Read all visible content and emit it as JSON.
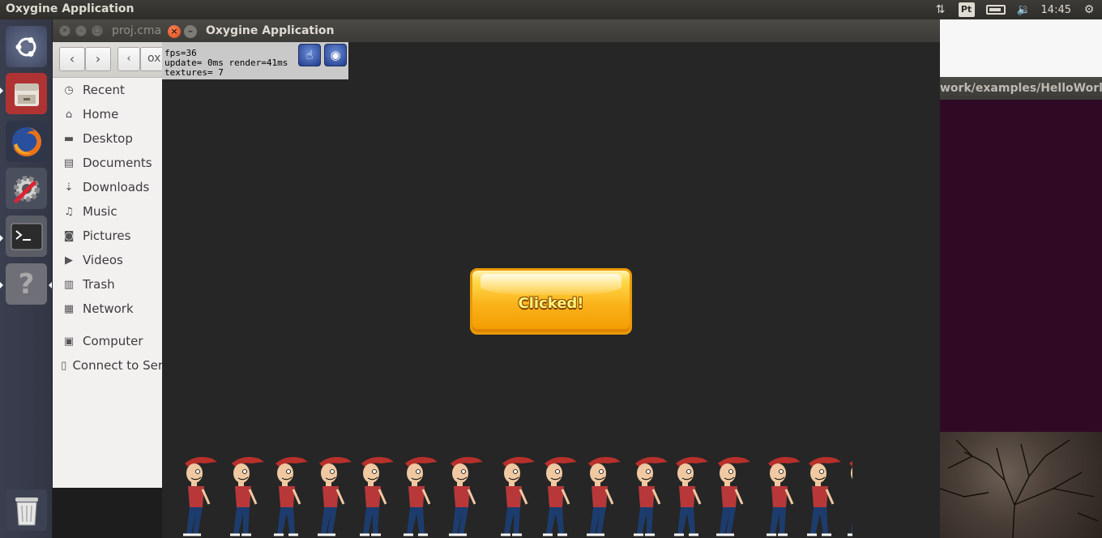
{
  "top_panel": {
    "app_title": "Oxygine Application",
    "keyboard_layout": "Pt",
    "clock": "14:45"
  },
  "launcher": {
    "items": [
      {
        "name": "dash-home-icon"
      },
      {
        "name": "files-icon"
      },
      {
        "name": "firefox-icon"
      },
      {
        "name": "system-settings-icon"
      },
      {
        "name": "terminal-icon"
      },
      {
        "name": "help-icon"
      },
      {
        "name": "trash-icon"
      }
    ]
  },
  "files_window": {
    "title": "proj.cma",
    "path_segment": "ox",
    "sidebar": [
      {
        "icon": "recent-icon",
        "label": "Recent"
      },
      {
        "icon": "home-icon",
        "label": "Home"
      },
      {
        "icon": "desktop-icon",
        "label": "Desktop"
      },
      {
        "icon": "documents-icon",
        "label": "Documents"
      },
      {
        "icon": "downloads-icon",
        "label": "Downloads"
      },
      {
        "icon": "music-icon",
        "label": "Music"
      },
      {
        "icon": "pictures-icon",
        "label": "Pictures"
      },
      {
        "icon": "videos-icon",
        "label": "Videos"
      },
      {
        "icon": "trash-icon",
        "label": "Trash"
      },
      {
        "icon": "network-icon",
        "label": "Network"
      },
      {
        "icon": "computer-icon",
        "label": "Computer"
      },
      {
        "icon": "connect-server-icon",
        "label": "Connect to Ser"
      }
    ]
  },
  "terminal_window": {
    "path": "work/examples/HelloWorld"
  },
  "oxygine_window": {
    "title": "Oxygine Application",
    "debug": {
      "line1": "fps=36",
      "line2": "update= 0ms render=41ms",
      "line3": "textures= 7"
    },
    "button_label": "Clicked!",
    "walker_count": 16
  },
  "colors": {
    "panel": "#3c3b37",
    "launcher": "#363a49",
    "terminal_bg": "#300a24",
    "close_button": "#df4a16",
    "button_orange": "#fbb21a"
  }
}
